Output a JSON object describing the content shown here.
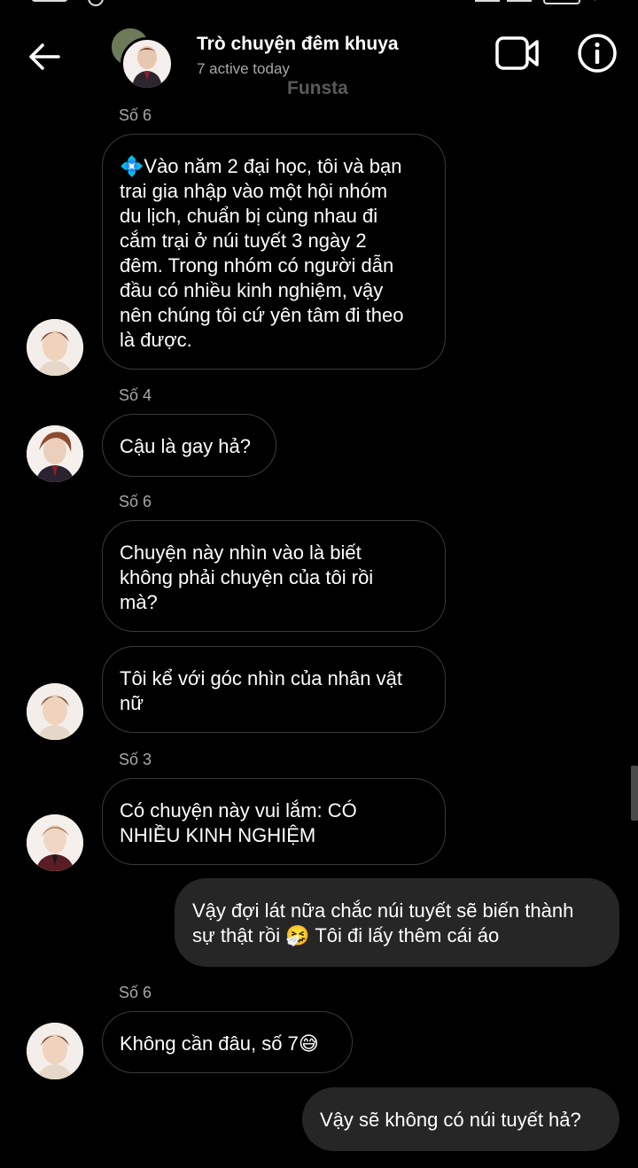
{
  "header": {
    "title": "Trò chuyện đêm khuya",
    "subtitle": "7 active today",
    "tag": "Funsta"
  },
  "messages": [
    {
      "sender": "Số 6",
      "text": "💠Vào năm 2 đại học, tôi và bạn\ntrai gia nhập vào một hội nhóm\ndu lịch, chuẩn bị cùng nhau đi\ncắm trại ở núi tuyết 3 ngày 2\nđêm. Trong nhóm có người dẫn\nđầu có nhiều kinh nghiệm, vậy\nnên chúng tôi cứ yên tâm đi theo\nlà được."
    },
    {
      "sender": "Số 4",
      "text": "Cậu là gay hả?"
    },
    {
      "sender": "Số 6",
      "text": "Chuyện này nhìn vào là biết\nkhông phải chuyện của tôi rồi\nmà?"
    },
    {
      "text": "Tôi kể với góc nhìn của nhân vật\nnữ"
    },
    {
      "sender": "Số 3",
      "text": "Có chuyện này vui lắm: CÓ\nNHIỀU KINH NGHIỆM"
    },
    {
      "text": "Vậy đợi lát nữa chắc núi tuyết sẽ biến thành\nsự thật rồi 🤧 Tôi đi lấy thêm cái áo"
    },
    {
      "sender": "Số 6",
      "text": "Không cần đâu, số 7😅"
    },
    {
      "text": "Vậy sẽ không có núi tuyết hả?"
    }
  ],
  "colors": {
    "background": "#000000",
    "incoming_border": "#3a3a3a",
    "outgoing_bubble": "#262626",
    "secondary_text": "#a8a8a8"
  },
  "icons": {
    "back": "arrow-left-icon",
    "video": "video-camera-icon",
    "info": "info-icon"
  }
}
